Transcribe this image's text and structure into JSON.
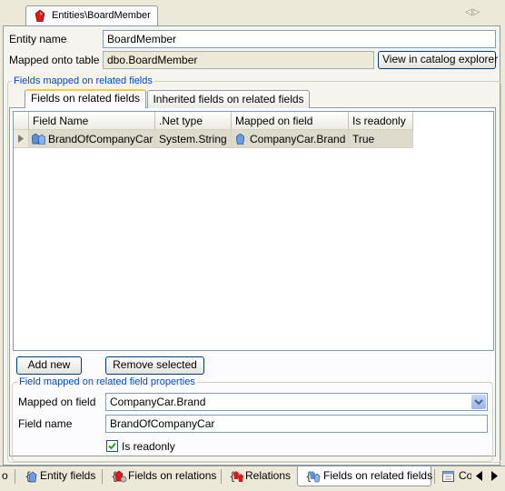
{
  "document_tab": {
    "title": "Entities\\BoardMember",
    "nav_arrows": "◁▷"
  },
  "entity": {
    "name_label": "Entity name",
    "name_value": "BoardMember",
    "mapped_label": "Mapped onto table",
    "mapped_value": "dbo.BoardMember",
    "catalog_button": "View in catalog explorer"
  },
  "group_fields": {
    "title": "Fields mapped on related fields",
    "tabs": [
      "Fields on related fields",
      "Inherited fields on related fields"
    ],
    "active_tab": 0,
    "columns": [
      "Field Name",
      ".Net type",
      "Mapped on field",
      "Is readonly"
    ],
    "rows": [
      {
        "field_name": "BrandOfCompanyCar",
        "net_type": "System.String",
        "mapped_on": "CompanyCar.Brand",
        "is_readonly": "True"
      }
    ],
    "add_button": "Add new",
    "remove_button": "Remove selected"
  },
  "properties": {
    "title": "Field mapped on related field properties",
    "mapped_label": "Mapped on field",
    "mapped_value": "CompanyCar.Brand",
    "field_name_label": "Field name",
    "field_name_value": "BrandOfCompanyCar",
    "readonly_label": "Is readonly",
    "readonly_checked": true
  },
  "bottom_tabs": {
    "partial_left": "o",
    "items": [
      "Entity fields",
      "Fields on relations",
      "Relations",
      "Fields on related fields",
      "Co"
    ],
    "active": 3
  },
  "colors": {
    "accent_blue": "#0046d5",
    "tab_highlight": "#ffc83c",
    "entity_icon": "#d81b1b"
  }
}
